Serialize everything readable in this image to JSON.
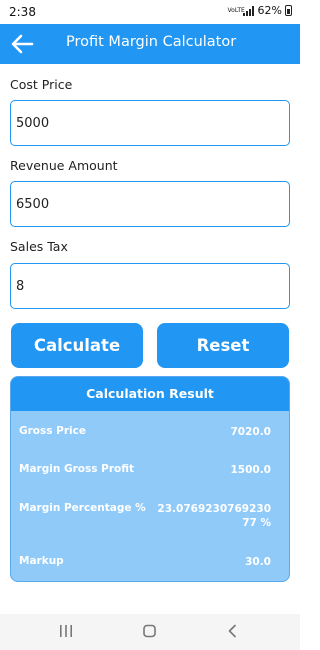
{
  "status_bar": {
    "time": "2:38",
    "network": "VoLTE",
    "battery": "62%"
  },
  "app_bar": {
    "title": "Profit Margin Calculator",
    "back_icon": "arrow-left-icon"
  },
  "form": {
    "cost_price": {
      "label": "Cost Price",
      "value": "5000"
    },
    "revenue_amount": {
      "label": "Revenue Amount",
      "value": "6500"
    },
    "sales_tax": {
      "label": "Sales Tax",
      "value": "8"
    }
  },
  "buttons": {
    "calculate": "Calculate",
    "reset": "Reset"
  },
  "result": {
    "title": "Calculation Result",
    "rows": [
      {
        "label": "Gross Price",
        "value": "7020.0"
      },
      {
        "label": "Margin Gross Profit",
        "value": "1500.0"
      },
      {
        "label": "Margin Percentage %",
        "value": "23.076923076923077 %"
      },
      {
        "label": "Markup",
        "value": "30.0"
      }
    ]
  },
  "colors": {
    "primary": "#2196f3",
    "result_background": "#90caf9"
  },
  "nav_bar": {
    "icons": [
      "recent-apps-icon",
      "home-icon",
      "back-icon"
    ]
  }
}
